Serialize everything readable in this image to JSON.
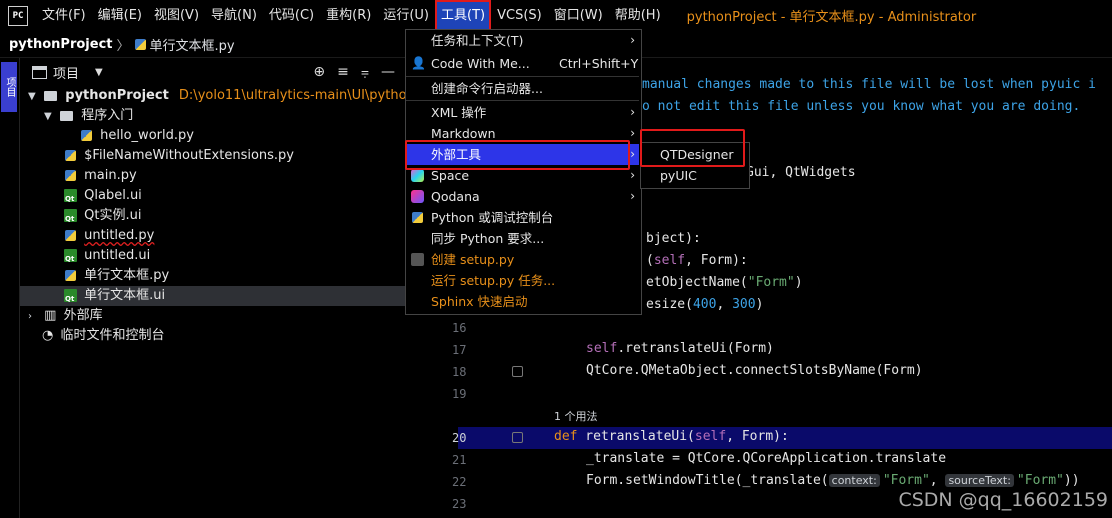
{
  "menubar": {
    "logo": "PC",
    "items": [
      "文件(F)",
      "编辑(E)",
      "视图(V)",
      "导航(N)",
      "代码(C)",
      "重构(R)",
      "运行(U)",
      "工具(T)",
      "VCS(S)",
      "窗口(W)",
      "帮助(H)"
    ],
    "window_title": "pythonProject - 单行文本框.py - Administrator"
  },
  "breadcrumb": {
    "project": "pythonProject",
    "file": "单行文本框.py"
  },
  "toolstrip": {
    "project_tab": "项目"
  },
  "panel": {
    "title": "项目",
    "tree": [
      {
        "label": "pythonProject",
        "path": "D:\\yolo11\\ultralytics-main\\UI\\pythonProject"
      },
      {
        "label": "程序入门"
      },
      {
        "label": "hello_world.py"
      },
      {
        "label": "$FileNameWithoutExtensions.py"
      },
      {
        "label": "main.py"
      },
      {
        "label": "Qlabel.ui"
      },
      {
        "label": "Qt实例.ui"
      },
      {
        "label": "untitled.py"
      },
      {
        "label": "untitled.ui"
      },
      {
        "label": "单行文本框.py"
      },
      {
        "label": "单行文本框.ui"
      },
      {
        "label": "外部库"
      },
      {
        "label": "临时文件和控制台"
      }
    ]
  },
  "editor": {
    "comment1": "manual changes made to this file will be lost when pyuic i",
    "comment2": "o not edit this file unless you know what you are doing.",
    "line_gui": "Gui, QtWidgets",
    "line_object": "bject):",
    "line_setup_a": "(",
    "line_setup_self": "self",
    "line_setup_b": ", Form):",
    "line_setname_a": "etObjectName(",
    "line_setname_str": "\"Form\"",
    "line_setname_b": ")",
    "line_resize_a": "esize(",
    "line_resize_n1": "400",
    "line_resize_sep": ", ",
    "line_resize_n2": "300",
    "line_resize_b": ")",
    "lines": [
      {
        "num": "16"
      },
      {
        "num": "17"
      },
      {
        "num": "18"
      },
      {
        "num": "19"
      },
      {
        "num": "20"
      },
      {
        "num": "21"
      },
      {
        "num": "22"
      },
      {
        "num": "23"
      }
    ],
    "l17_self": "self",
    "l17_rest": ".retranslateUi(Form)",
    "l18": "QtCore.QMetaObject.connectSlotsByName(Form)",
    "usage": "1 个用法",
    "l20_def": "def",
    "l20_name": " retranslateUi(",
    "l20_self": "self",
    "l20_rest": ", Form):",
    "l21": "_translate = QtCore.QCoreApplication.translate",
    "l22_a": "Form.setWindowTitle(_translate(",
    "l22_hint1": "context:",
    "l22_str1": "\"Form\"",
    "l22_sep": ", ",
    "l22_hint2": "sourceText:",
    "l22_str2": "\"Form\"",
    "l22_b": "))"
  },
  "tools_menu": {
    "items": [
      {
        "label": "任务和上下文(T)",
        "submenu": true
      },
      {
        "label": "Code With Me...",
        "shortcut": "Ctrl+Shift+Y"
      },
      {
        "label": "创建命令行启动器..."
      },
      {
        "label": "XML 操作",
        "submenu": true
      },
      {
        "label": "Markdown",
        "submenu": true
      },
      {
        "label": "外部工具",
        "submenu": true
      },
      {
        "label": "Space",
        "submenu": true
      },
      {
        "label": "Qodana",
        "submenu": true
      },
      {
        "label": "Python 或调试控制台"
      },
      {
        "label": "同步 Python 要求..."
      },
      {
        "label": "创建 setup.py"
      },
      {
        "label": "运行 setup.py 任务..."
      },
      {
        "label": "Sphinx 快速启动"
      }
    ]
  },
  "external_tools_submenu": {
    "items": [
      "QTDesigner",
      "pyUIC"
    ]
  },
  "watermark": "CSDN @qq_16602159",
  "colors": {
    "accent_orange": "#e8901a",
    "highlight_blue": "#2d35e8",
    "red_box": "#e11a1a"
  }
}
